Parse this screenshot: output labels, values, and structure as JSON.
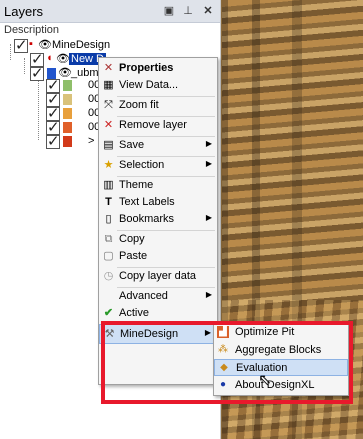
{
  "panel": {
    "title": "Layers",
    "column_header": "Description",
    "icons": [
      "pin-icon",
      "autohide-icon",
      "close-icon"
    ]
  },
  "tree": {
    "root": "MineDesign",
    "selected": "New D",
    "child2": "_ubmi",
    "items": [
      "00",
      "00",
      "00",
      "00",
      ">"
    ]
  },
  "menu": {
    "properties": "Properties",
    "view_data": "View Data...",
    "zoom_fit": "Zoom fit",
    "remove_layer": "Remove layer",
    "save": "Save",
    "selection": "Selection",
    "theme": "Theme",
    "text_labels": "Text Labels",
    "bookmarks": "Bookmarks",
    "copy": "Copy",
    "paste": "Paste",
    "copy_layer_data": "Copy layer data",
    "advanced": "Advanced",
    "active": "Active",
    "minedesign": "MineDesign"
  },
  "submenu": {
    "optimize_pit": "Optimize Pit",
    "aggregate_blocks": "Aggregate Blocks",
    "evaluation": "Evaluation",
    "about": "About DesignXL"
  },
  "colors": {
    "highlight": "#cfe0f5",
    "annotation": "#e8192c"
  }
}
